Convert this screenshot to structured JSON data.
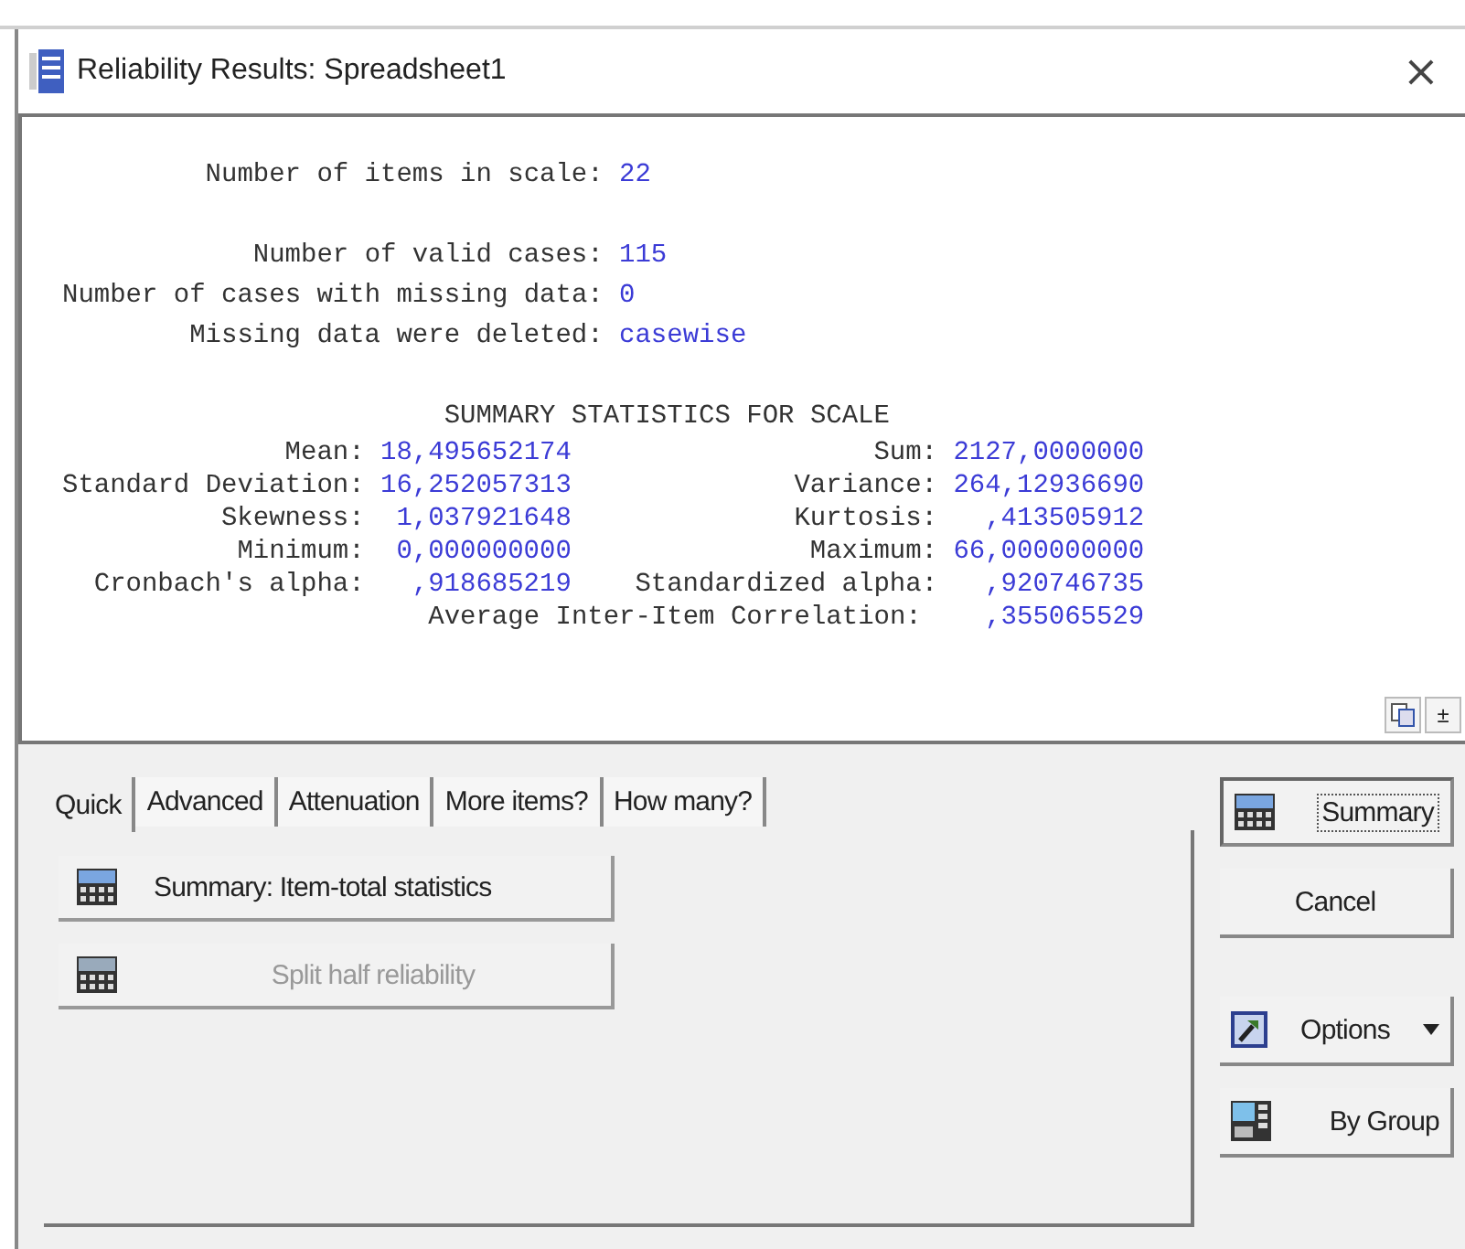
{
  "window": {
    "title": "Reliability Results: Spreadsheet1",
    "close": "×"
  },
  "output": {
    "info_groups": [
      [
        {
          "label": "Number of items in scale:",
          "value": "22"
        }
      ],
      [
        {
          "label": "Number of valid cases:",
          "value": "115"
        },
        {
          "label": "Number of cases with missing data:",
          "value": "0"
        },
        {
          "label": "Missing data were deleted:",
          "value": "casewise"
        }
      ]
    ],
    "summary_title": "SUMMARY STATISTICS FOR SCALE",
    "summary_rows": [
      {
        "left_label": "Mean:",
        "left_value": "18,495652174",
        "right_label": "Sum:",
        "right_value": "2127,0000000"
      },
      {
        "left_label": "Standard Deviation:",
        "left_value": "16,252057313",
        "right_label": "Variance:",
        "right_value": "264,12936690"
      },
      {
        "left_label": "Skewness:",
        "left_value": "1,037921648",
        "right_label": "Kurtosis:",
        "right_value": ",413505912"
      },
      {
        "left_label": "Minimum:",
        "left_value": "0,000000000",
        "right_label": "Maximum:",
        "right_value": "66,000000000"
      },
      {
        "left_label": "Cronbach's alpha:",
        "left_value": ",918685219",
        "right_label": "Standardized alpha:",
        "right_value": ",920746735"
      },
      {
        "right_label": "Average Inter-Item Correlation:",
        "right_value": ",355065529"
      }
    ],
    "collapse_button": "±"
  },
  "tabs": [
    {
      "label": "Quick",
      "selected": true
    },
    {
      "label": "Advanced",
      "selected": false
    },
    {
      "label": "Attenuation",
      "selected": false
    },
    {
      "label": "More items?",
      "selected": false
    },
    {
      "label": "How many?",
      "selected": false
    }
  ],
  "quick_buttons": [
    {
      "label": "Summary:  Item-total statistics",
      "disabled": false
    },
    {
      "label": "Split half reliability",
      "disabled": true
    }
  ],
  "side_buttons": [
    {
      "label": "Summary",
      "kind": "summary",
      "default": true
    },
    {
      "label": "Cancel",
      "kind": "plain",
      "default": false
    },
    {
      "label": "Options",
      "kind": "options",
      "default": false
    },
    {
      "label": "By Group",
      "kind": "group",
      "default": false
    }
  ]
}
